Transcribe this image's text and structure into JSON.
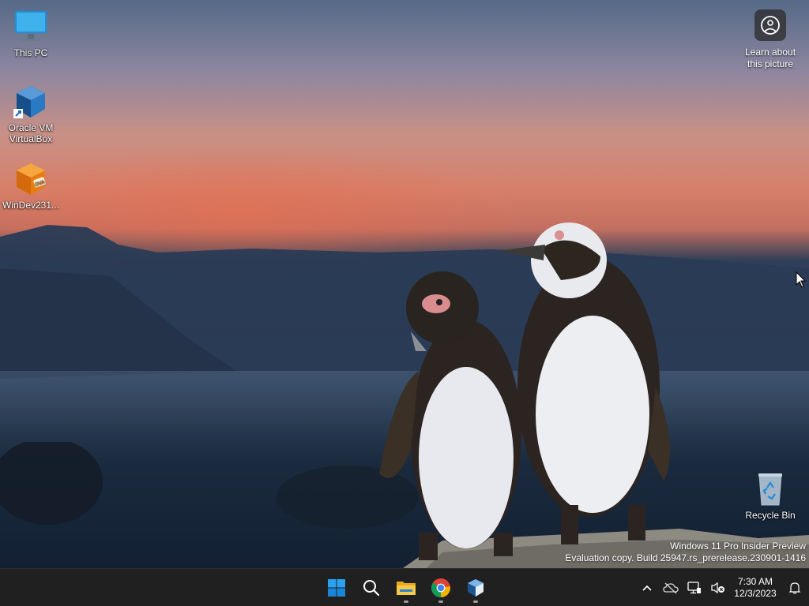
{
  "desktop": {
    "icons": [
      {
        "label": "This PC",
        "icon": "monitor-icon"
      },
      {
        "label": "Oracle VM VirtualBox",
        "icon": "virtualbox-icon"
      },
      {
        "label": "WinDev231...",
        "icon": "ova-package-icon"
      },
      {
        "label": "Recycle Bin",
        "icon": "recycle-bin-icon"
      }
    ],
    "learn_about_picture": {
      "label": "Learn about this picture",
      "icon": "camera-compass-icon"
    },
    "watermark": {
      "line1": "Windows 11 Pro Insider Preview",
      "line2": "Evaluation copy. Build 25947.rs_prerelease.230901-1416"
    }
  },
  "taskbar": {
    "apps": [
      {
        "name": "Start",
        "icon": "windows-start-icon",
        "running": false
      },
      {
        "name": "Search",
        "icon": "search-icon",
        "running": false
      },
      {
        "name": "File Explorer",
        "icon": "folder-icon",
        "running": true
      },
      {
        "name": "Google Chrome",
        "icon": "chrome-icon",
        "running": true
      },
      {
        "name": "Oracle VM VirtualBox",
        "icon": "virtualbox-icon",
        "running": true
      }
    ],
    "tray": {
      "icons": [
        "chevron-up-icon",
        "onedrive-offline-icon",
        "network-icon",
        "volume-muted-icon"
      ],
      "time": "7:30 AM",
      "date": "12/3/2023",
      "notification_icon": "bell-icon"
    }
  },
  "colors": {
    "taskbar_bg": "#202020",
    "accent_blue": "#0078d4",
    "folder_yellow": "#f3c343"
  }
}
